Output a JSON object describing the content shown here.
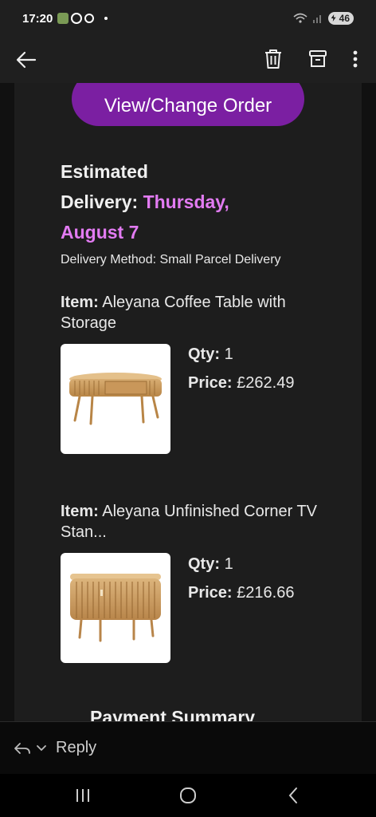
{
  "status_bar": {
    "time": "17:20",
    "battery": "46",
    "icons": [
      "photo-app-icon",
      "ring-icon",
      "chrome-icon",
      "dot",
      "wifi-icon",
      "signal-icon",
      "battery-icon"
    ]
  },
  "app_bar": {
    "icons": [
      "back-arrow-icon",
      "trash-icon",
      "archive-icon",
      "more-vert-icon"
    ]
  },
  "email": {
    "button_label": "View/Change Order",
    "estimated_label": "Estimated",
    "delivery_label": "Delivery:",
    "delivery_date_line1": "Thursday,",
    "delivery_date_line2": "August 7",
    "delivery_method": "Delivery Method: Small Parcel Delivery",
    "items": [
      {
        "item_label": "Item:",
        "name": "Aleyana Coffee Table with Storage",
        "qty_label": "Qty:",
        "qty": "1",
        "price_label": "Price:",
        "price": "£262.49",
        "image": "coffee-table-image"
      },
      {
        "item_label": "Item:",
        "name": "Aleyana Unfinished Corner TV Stan...",
        "qty_label": "Qty:",
        "qty": "1",
        "price_label": "Price:",
        "price": "£216.66",
        "image": "tv-stand-image"
      }
    ],
    "payment_summary_heading": "Payment Summary"
  },
  "reply_bar": {
    "label": "Reply"
  },
  "colors": {
    "accent_button": "#7b1fa2",
    "delivery_date": "#e27bf2",
    "background": "#1d1d1d"
  }
}
